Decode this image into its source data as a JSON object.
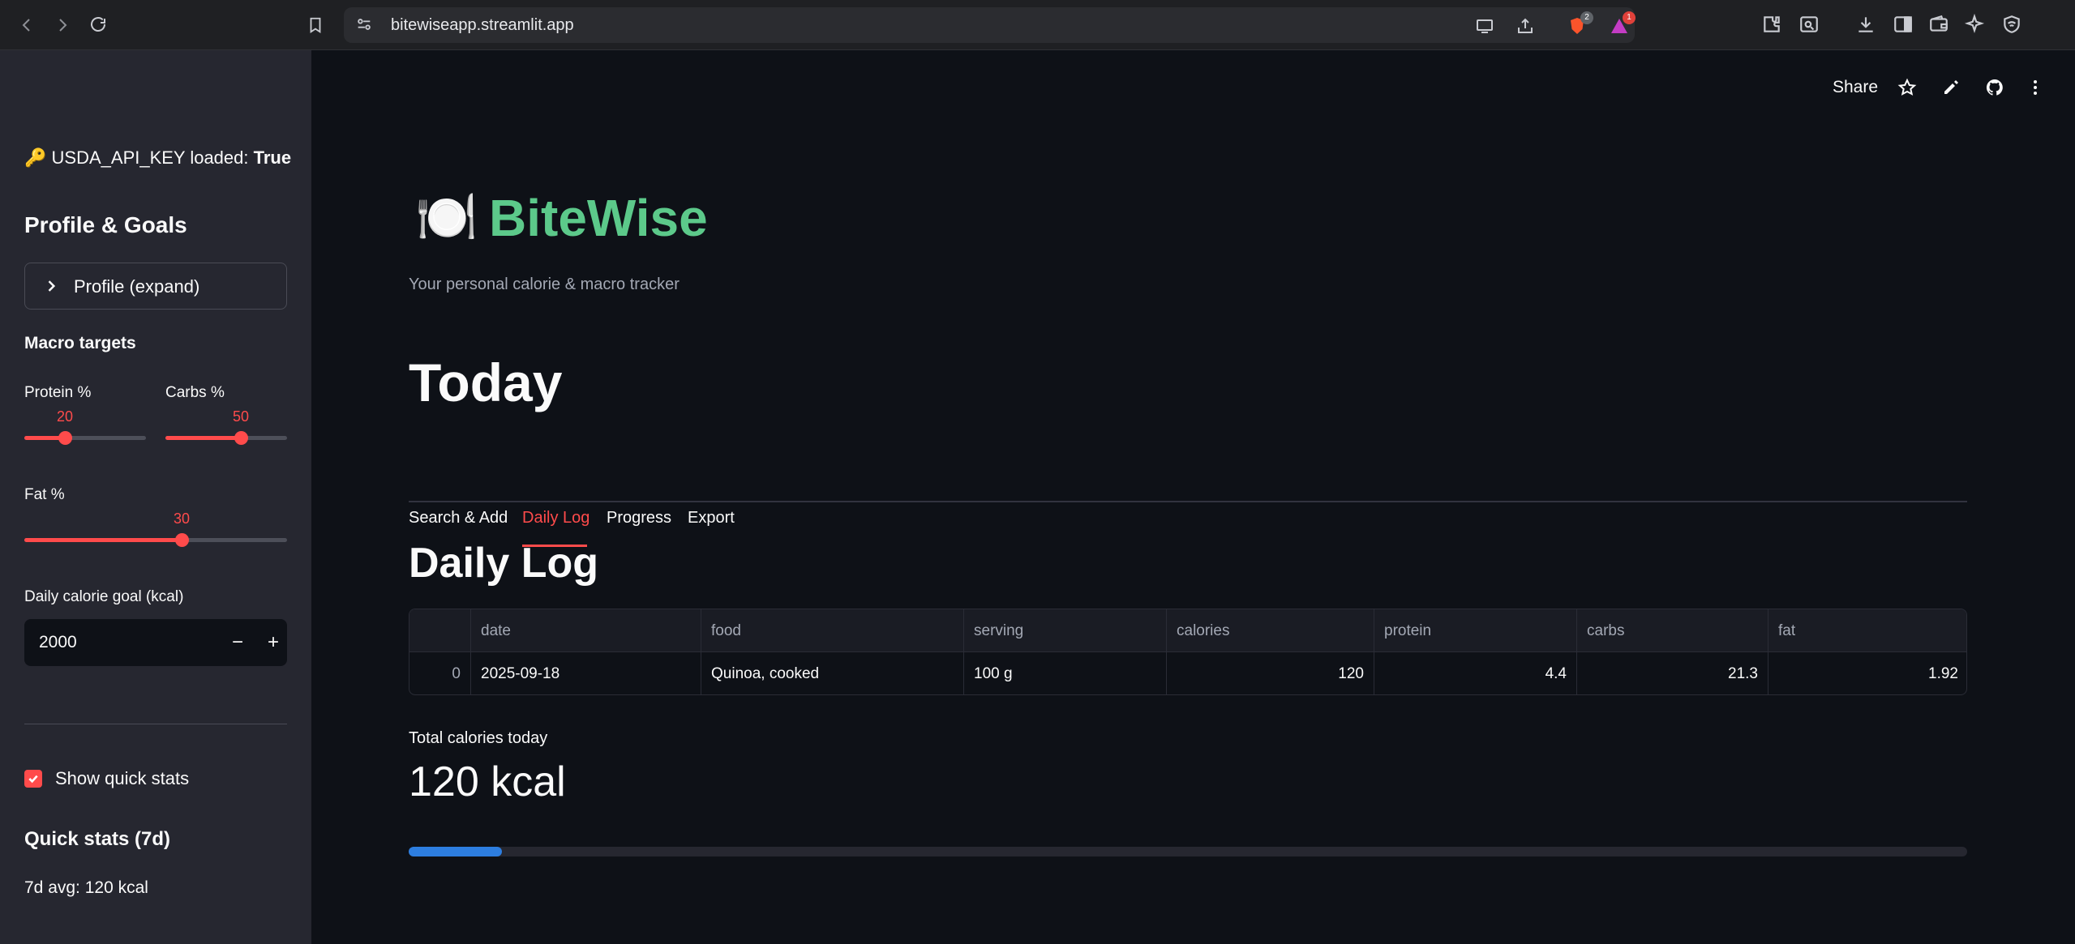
{
  "browser": {
    "url": "bitewiseapp.streamlit.app",
    "brave_badge": "2",
    "alert_badge": "1"
  },
  "sidebar": {
    "api_key_prefix": "USDA_API_KEY loaded: ",
    "api_key_value": "True",
    "profile_heading": "Profile & Goals",
    "profile_expander": "Profile (expand)",
    "macro_heading": "Macro targets",
    "protein": {
      "label": "Protein %",
      "value": "20",
      "min": 0,
      "max": 60,
      "level": 20
    },
    "carbs": {
      "label": "Carbs %",
      "value": "50",
      "min": 0,
      "max": 80,
      "level": 50
    },
    "fat": {
      "label": "Fat %",
      "value": "30",
      "min": 0,
      "max": 50,
      "level": 30
    },
    "calorie_goal_label": "Daily calorie goal (kcal)",
    "calorie_goal_value": "2000",
    "minus": "−",
    "plus": "+",
    "quick_stats_checkbox": "Show quick stats",
    "quick_stats_checked": true,
    "quick_stats_heading": "Quick stats (7d)",
    "quick_stats_avg": "7d avg: 120 kcal"
  },
  "header": {
    "share": "Share"
  },
  "main": {
    "logo_emoji": "🍽️",
    "app_title": "BiteWise",
    "subtitle": "Your personal calorie & macro tracker",
    "page_title": "Today",
    "tabs": [
      {
        "label": "Search & Add"
      },
      {
        "label": "Daily Log"
      },
      {
        "label": "Progress"
      },
      {
        "label": "Export"
      }
    ],
    "active_tab": 1,
    "section_title": "Daily Log",
    "table": {
      "columns": [
        "",
        "date",
        "food",
        "serving",
        "calories",
        "protein",
        "carbs",
        "fat"
      ],
      "rows": [
        [
          "0",
          "2025-09-18",
          "Quinoa, cooked",
          "100 g",
          "120",
          "4.4",
          "21.3",
          "1.92"
        ]
      ]
    },
    "metric_label": "Total calories today",
    "metric_value": "120 kcal",
    "progress_fraction": 0.06
  },
  "colors": {
    "accent": "#ff4b4b",
    "title_green": "#5cc98a",
    "progress_blue": "#2d7ee0",
    "background": "#0e1117",
    "sidebar_bg": "#262730"
  }
}
